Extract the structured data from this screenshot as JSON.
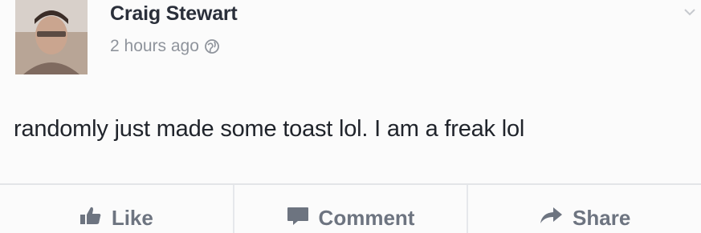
{
  "post": {
    "author": "Craig Stewart",
    "timestamp": "2 hours ago",
    "text": "randomly just made some toast lol. I am a freak lol"
  },
  "actions": [
    {
      "label": "Like",
      "icon": "thumbs-up-icon"
    },
    {
      "label": "Comment",
      "icon": "comment-icon"
    },
    {
      "label": "Share",
      "icon": "share-arrow-icon"
    }
  ],
  "colors": {
    "background": "#fbfbfb",
    "text": "#20242b",
    "muted": "#8f949c",
    "action": "#6d7480"
  }
}
